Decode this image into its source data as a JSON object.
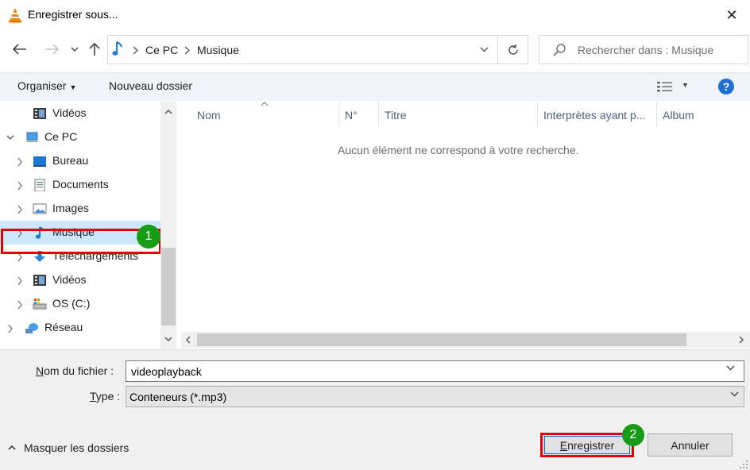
{
  "window": {
    "title": "Enregistrer sous...",
    "app_icon": "vlc-cone-icon",
    "close_glyph": "✕"
  },
  "navigation": {
    "back_icon": "arrow-left-icon",
    "forward_icon": "arrow-right-icon",
    "recent_icon": "chevron-down-icon",
    "up_icon": "arrow-up-icon",
    "address": {
      "location_icon": "music-note-icon",
      "segments": [
        "Ce PC",
        "Musique"
      ]
    },
    "refresh_icon": "refresh-icon",
    "search_placeholder": "Rechercher dans : Musique"
  },
  "toolbar": {
    "organize_label": "Organiser",
    "new_folder_label": "Nouveau dossier",
    "view_icon": "details-view-icon",
    "help_label": "?"
  },
  "tree": {
    "items": [
      {
        "label": "Vidéos",
        "icon": "video-icon",
        "indent": 1,
        "expander": ""
      },
      {
        "label": "Ce PC",
        "icon": "computer-icon",
        "indent": 0,
        "expander": "expanded"
      },
      {
        "label": "Bureau",
        "icon": "desktop-icon",
        "indent": 1,
        "expander": "collapsed"
      },
      {
        "label": "Documents",
        "icon": "documents-icon",
        "indent": 1,
        "expander": "collapsed"
      },
      {
        "label": "Images",
        "icon": "pictures-icon",
        "indent": 1,
        "expander": "collapsed"
      },
      {
        "label": "Musique",
        "icon": "music-note-icon",
        "indent": 1,
        "expander": "collapsed",
        "selected": true
      },
      {
        "label": "Téléchargements",
        "icon": "downloads-icon",
        "indent": 1,
        "expander": "collapsed"
      },
      {
        "label": "Vidéos",
        "icon": "video-icon",
        "indent": 1,
        "expander": "collapsed"
      },
      {
        "label": "OS (C:)",
        "icon": "drive-icon",
        "indent": 1,
        "expander": "collapsed"
      },
      {
        "label": "Réseau",
        "icon": "network-icon",
        "indent": 0,
        "expander": "collapsed"
      }
    ]
  },
  "content": {
    "columns": [
      "Nom",
      "N°",
      "Titre",
      "Interprètes ayant p...",
      "Album"
    ],
    "empty_message": "Aucun élément ne correspond à votre recherche."
  },
  "form": {
    "filename_label": "Nom du fichier :",
    "filename_value": "videoplayback",
    "type_label": "Type :",
    "type_value": "Conteneurs (*.mp3)"
  },
  "footer": {
    "hide_folders_label": "Masquer les dossiers",
    "save_label": "Enregistrer",
    "cancel_label": "Annuler"
  },
  "annotations": {
    "badge_1": "1",
    "badge_2": "2",
    "highlight_color": "#e60000",
    "badge_color": "#169c16"
  },
  "colors": {
    "selection": "#cce8ff",
    "toolbar_bg": "#f0f3f7",
    "accent": "#1f6fd0"
  }
}
